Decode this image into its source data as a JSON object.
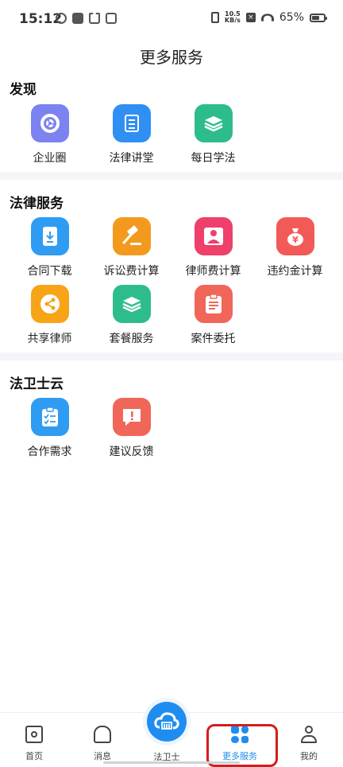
{
  "status_bar": {
    "time": "15:12",
    "net_speed": "10.5",
    "net_unit": "KB/s",
    "battery": "65%",
    "battery_level": 0.65
  },
  "page_title": "更多服务",
  "sections": {
    "discover": {
      "title": "发现",
      "items": [
        {
          "label": "企业圈",
          "icon": "aperture-icon",
          "color": "#7b83f0"
        },
        {
          "label": "法律讲堂",
          "icon": "book-icon",
          "color": "#2f8ff3"
        },
        {
          "label": "每日学法",
          "icon": "layers-icon",
          "color": "#2dbd8c"
        }
      ]
    },
    "legal": {
      "title": "法律服务",
      "items": [
        {
          "label": "合同下载",
          "icon": "download-icon",
          "color": "#2f9cf3"
        },
        {
          "label": "诉讼费计算",
          "icon": "gavel-icon",
          "color": "#f39a1e"
        },
        {
          "label": "律师费计算",
          "icon": "lawyer-icon",
          "color": "#ef3f6b"
        },
        {
          "label": "违约金计算",
          "icon": "money-bag-icon",
          "color": "#f15a57"
        },
        {
          "label": "共享律师",
          "icon": "share-icon",
          "color": "#f7a417"
        },
        {
          "label": "套餐服务",
          "icon": "layers-icon",
          "color": "#2dbd8c"
        },
        {
          "label": "案件委托",
          "icon": "clipboard-icon",
          "color": "#f06659"
        }
      ]
    },
    "cloud": {
      "title": "法卫士云",
      "items": [
        {
          "label": "合作需求",
          "icon": "checklist-icon",
          "color": "#2f9cf3"
        },
        {
          "label": "建议反馈",
          "icon": "feedback-icon",
          "color": "#f06659"
        }
      ]
    }
  },
  "glyphs": {
    "download": "⬇",
    "yuan": "¥",
    "share": "⋖",
    "alert": "!",
    "gavel": "⚒",
    "person": "♟",
    "clip": "≡",
    "check": "☑"
  },
  "bottom_nav": {
    "home": "首页",
    "messages": "消息",
    "center": "法卫士",
    "more": "更多服务",
    "mine": "我的"
  },
  "colors": {
    "accent": "#1f8df0",
    "highlight": "#d51c1c"
  }
}
